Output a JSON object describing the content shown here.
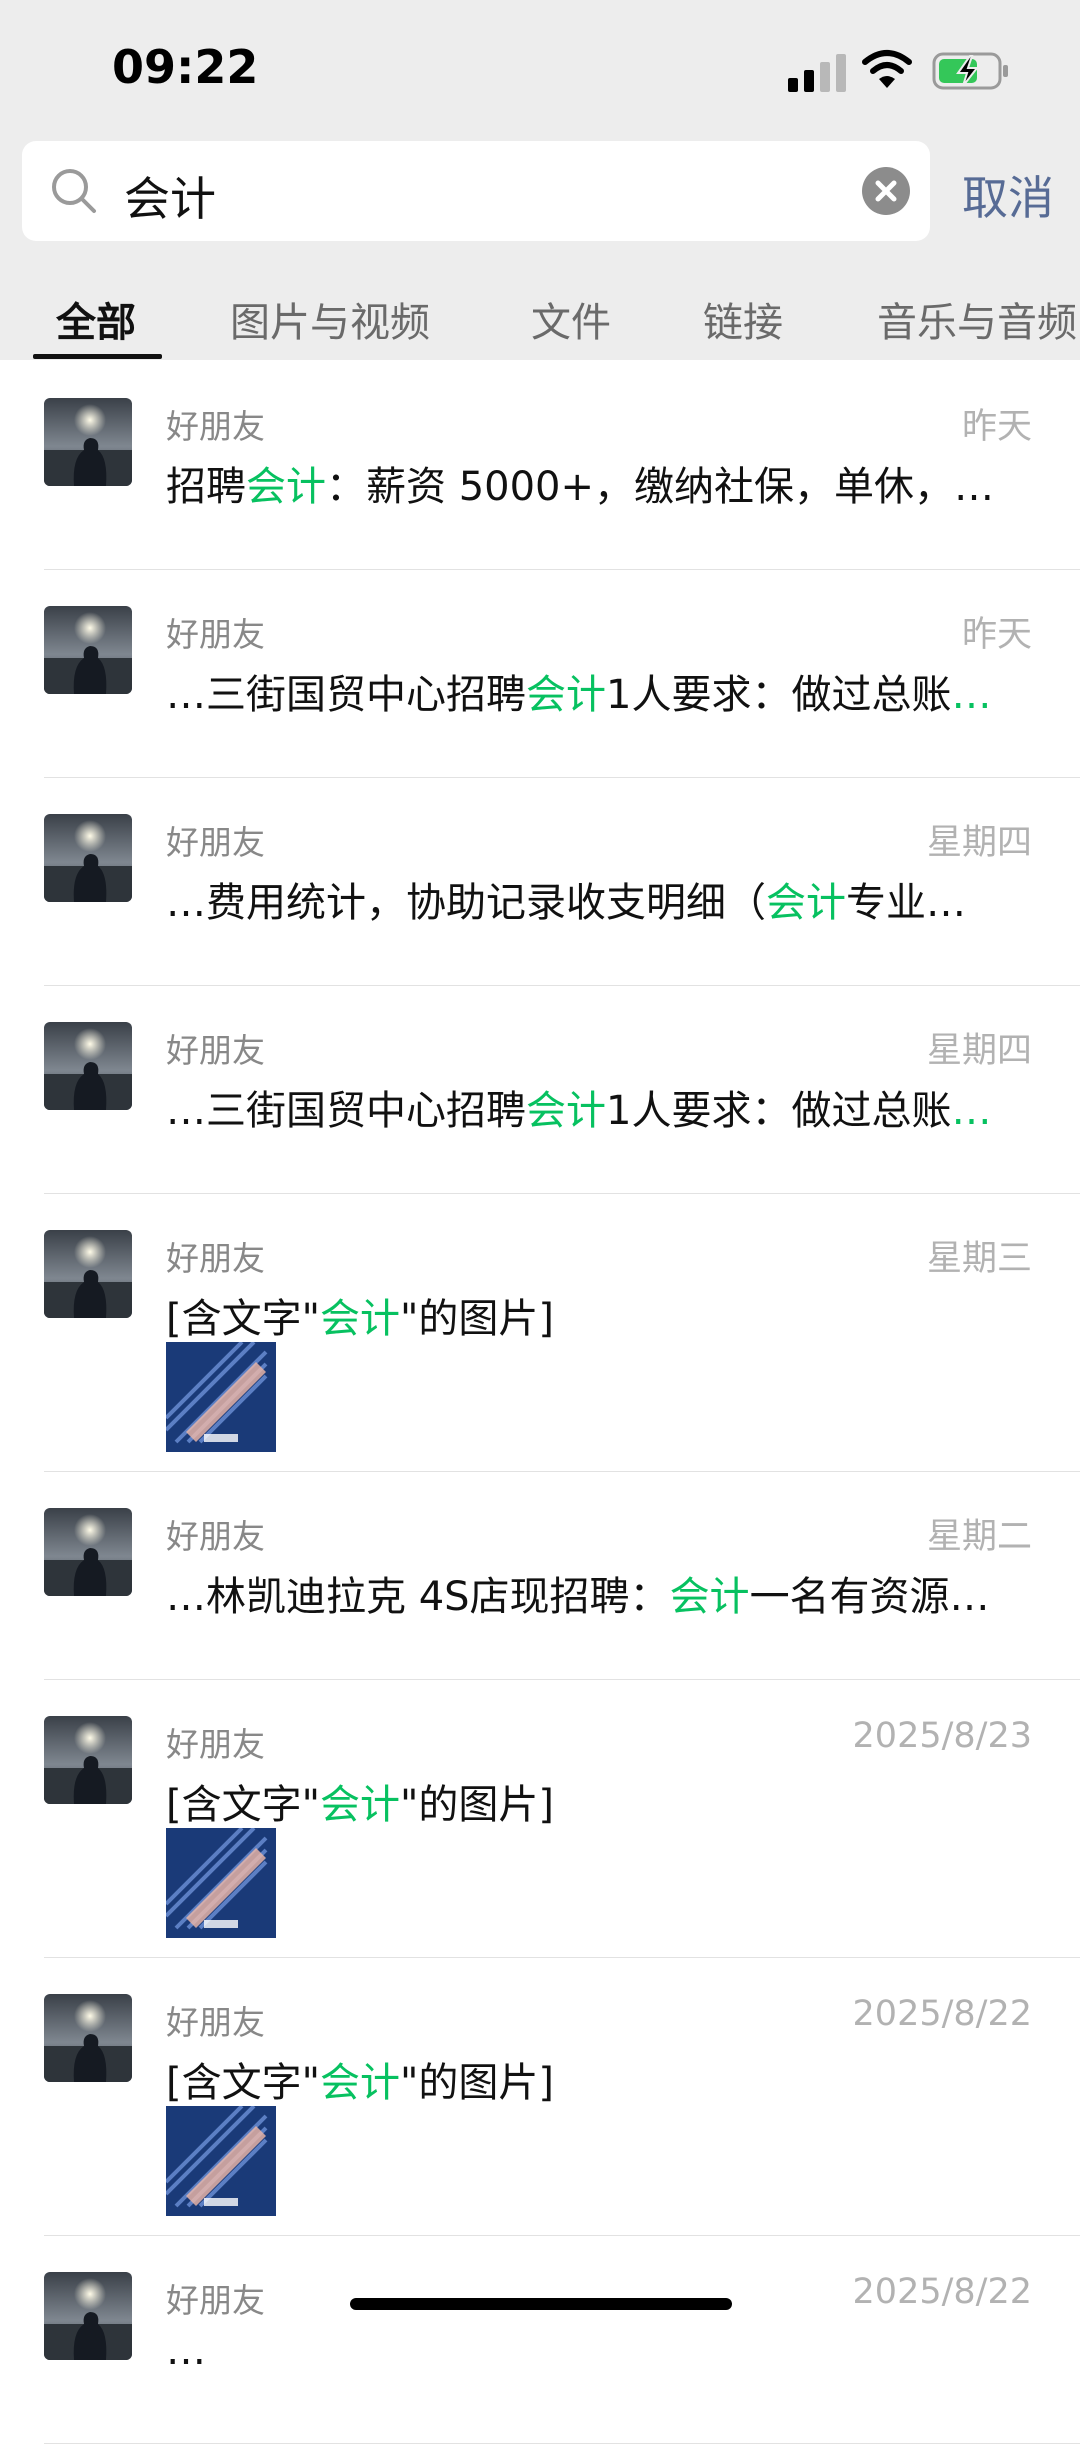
{
  "status_bar": {
    "time": "09:22"
  },
  "search": {
    "query": "会计",
    "cancel_label": "取消"
  },
  "tabs": [
    {
      "label": "全部",
      "active": true
    },
    {
      "label": "图片与视频",
      "active": false
    },
    {
      "label": "文件",
      "active": false
    },
    {
      "label": "链接",
      "active": false
    },
    {
      "label": "音乐与音频",
      "active": false
    }
  ],
  "results": [
    {
      "name": "好朋友",
      "time": "昨天",
      "pre": "招聘",
      "hl": "会计",
      "post": "：薪资 5000+，缴纳社保，单休，…",
      "hl2": "",
      "thumbnail": false
    },
    {
      "name": "好朋友",
      "time": "昨天",
      "pre": "…三街国贸中心招聘",
      "hl": "会计",
      "post": "1人要求：做过总账",
      "hl2": "…",
      "thumbnail": false
    },
    {
      "name": "好朋友",
      "time": "星期四",
      "pre": "…费用统计，协助记录收支明细（",
      "hl": "会计",
      "post": "专业…",
      "hl2": "",
      "thumbnail": false
    },
    {
      "name": "好朋友",
      "time": "星期四",
      "pre": "…三街国贸中心招聘",
      "hl": "会计",
      "post": "1人要求：做过总账",
      "hl2": "…",
      "thumbnail": false
    },
    {
      "name": "好朋友",
      "time": "星期三",
      "pre": "[含文字\"",
      "hl": "会计",
      "post": "\"的图片]",
      "hl2": "",
      "thumbnail": true
    },
    {
      "name": "好朋友",
      "time": "星期二",
      "pre": "…林凯迪拉克 4S店现招聘：",
      "hl": "会计",
      "post": "一名有资源…",
      "hl2": "",
      "thumbnail": false
    },
    {
      "name": "好朋友",
      "time": "2025/8/23",
      "pre": "[含文字\"",
      "hl": "会计",
      "post": "\"的图片]",
      "hl2": "",
      "thumbnail": true
    },
    {
      "name": "好朋友",
      "time": "2025/8/22",
      "pre": "[含文字\"",
      "hl": "会计",
      "post": "\"的图片]",
      "hl2": "",
      "thumbnail": true
    },
    {
      "name": "好朋友",
      "time": "2025/8/22",
      "pre": "…",
      "hl": "",
      "post": "",
      "hl2": "",
      "thumbnail": false
    }
  ],
  "colors": {
    "highlight": "#07c160",
    "link": "#576b95"
  }
}
